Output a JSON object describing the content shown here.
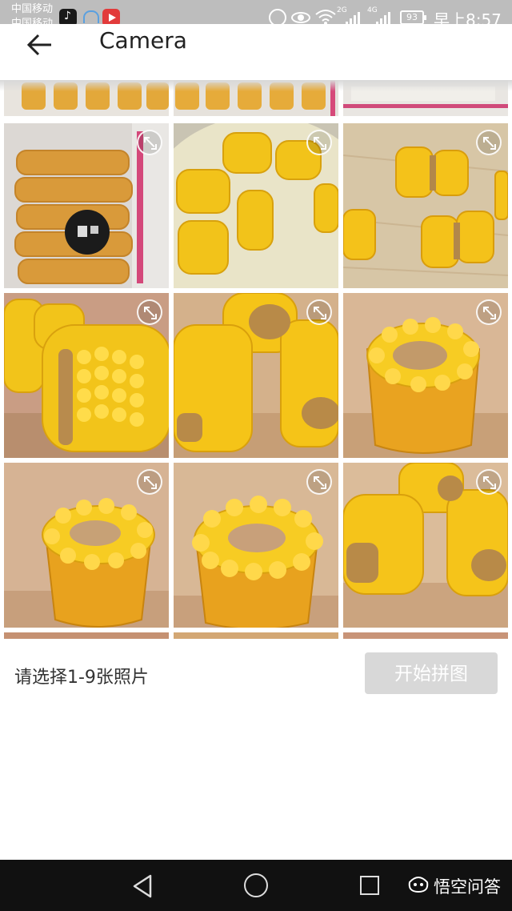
{
  "status": {
    "carrier_1": "中国移动",
    "carrier_2": "中国移动",
    "network_1": "2G",
    "network_2": "4G",
    "battery": "93",
    "time": "早上8:57"
  },
  "appbar": {
    "title": "Camera",
    "back_icon": "arrow-left-icon"
  },
  "grid": {
    "expand_icon": "expand-icon",
    "photos": [
      "corn-frozen-bags",
      "corn-in-water",
      "corn-cut-board",
      "corn-closeup",
      "corn-pieces",
      "corn-standing",
      "corn-standing-2",
      "corn-standing-3",
      "corn-pieces-2"
    ]
  },
  "bottom": {
    "hint": "请选择1-9张照片",
    "start_button": "开始拼图"
  },
  "watermark": {
    "text": "悟空问答"
  },
  "colors": {
    "corn_yellow": "#f2c41a",
    "button_disabled": "#d8d8d8",
    "status_bar": "#bdbdbd"
  }
}
